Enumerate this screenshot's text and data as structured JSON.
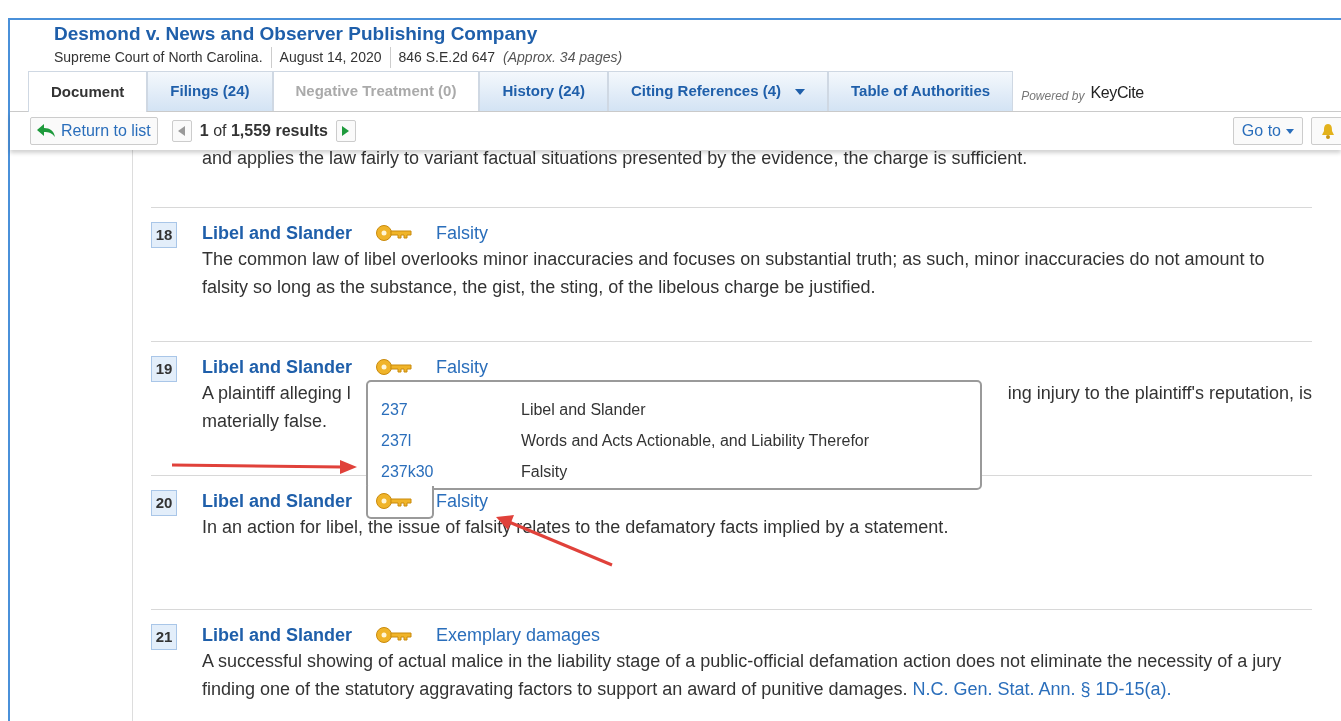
{
  "document": {
    "title": "Desmond v. News and Observer Publishing Company",
    "court": "Supreme Court of North Carolina.",
    "date": "August 14, 2020",
    "citation": "846 S.E.2d 647",
    "length": "(Approx. 34 pages)"
  },
  "tabs": [
    {
      "label": "Document",
      "selected": true,
      "disabled": false
    },
    {
      "label": "Filings (24)",
      "selected": false,
      "disabled": false
    },
    {
      "label": "Negative Treatment (0)",
      "selected": false,
      "disabled": true
    },
    {
      "label": "History (24)",
      "selected": false,
      "disabled": false
    },
    {
      "label": "Citing References (4)",
      "selected": false,
      "disabled": false,
      "dropdown": true
    },
    {
      "label": "Table of Authorities",
      "selected": false,
      "disabled": false
    }
  ],
  "powered_by": {
    "label": "Powered by",
    "brand": "KeyCite"
  },
  "toolbar": {
    "return_label": "Return to list",
    "pager": "**1** of **1,559 results**",
    "prev_disabled": true,
    "next_disabled": false,
    "goto_label": "Go to"
  },
  "cut_text": "and applies the law fairly to variant factual situations presented by the evidence, the charge is sufficient.",
  "headnotes": [
    {
      "kind": "full",
      "number": "18",
      "topic": "Libel and Slander",
      "subtopic": "Falsity",
      "text": "The common law of libel overlooks minor inaccuracies and focuses on substantial truth; as such, minor inaccuracies do not amount to falsity so long as the substance, the gist, the sting, of the libelous charge be justified."
    },
    {
      "kind": "covered",
      "number": "19",
      "topic": "Libel and Slander",
      "subtopic": "Falsity",
      "line_1_start": "A plaintiff alleging l",
      "line_1_end": "ing injury to the plaintiff's reputation, is",
      "line_2": "materially false."
    },
    {
      "kind": "full",
      "number": "20",
      "topic": "Libel and Slander",
      "subtopic": "Falsity",
      "text": "In an action for libel, the issue of falsity relates to the defamatory facts implied by a statement."
    },
    {
      "kind": "full",
      "number": "21",
      "topic": "Libel and Slander",
      "subtopic": "Exemplary damages",
      "text": "A successful showing of actual malice in the liability stage of a public-official defamation action does not eliminate the necessity of a jury finding one of the statutory aggravating factors to support an award of punitive damages.",
      "link": "N.C. Gen. Stat. Ann. § 1D-15(a)."
    }
  ],
  "key_popup": {
    "rows": [
      {
        "code": "237",
        "label": "Libel and Slander"
      },
      {
        "code": "237l",
        "label": "Words and Acts Actionable, and Liability Therefor"
      },
      {
        "code": "237k30",
        "label": "Falsity"
      }
    ]
  }
}
